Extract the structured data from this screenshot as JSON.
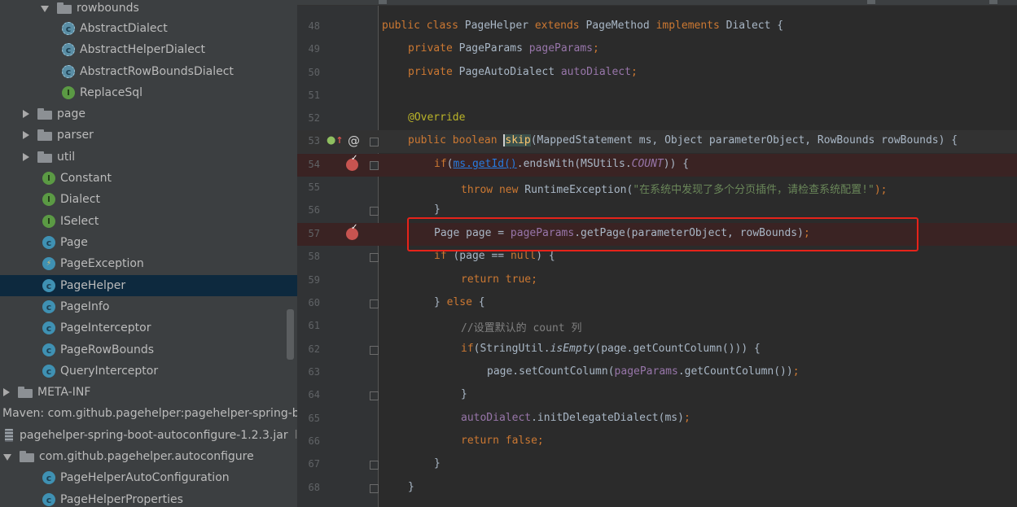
{
  "project_tree": {
    "items": [
      {
        "label": "rowbounds",
        "kind": "folder"
      },
      {
        "label": "AbstractDialect",
        "kind": "abstract-class"
      },
      {
        "label": "AbstractHelperDialect",
        "kind": "abstract-class"
      },
      {
        "label": "AbstractRowBoundsDialect",
        "kind": "abstract-class"
      },
      {
        "label": "ReplaceSql",
        "kind": "interface"
      },
      {
        "label": "page",
        "kind": "folder"
      },
      {
        "label": "parser",
        "kind": "folder"
      },
      {
        "label": "util",
        "kind": "folder"
      },
      {
        "label": "Constant",
        "kind": "interface"
      },
      {
        "label": "Dialect",
        "kind": "interface"
      },
      {
        "label": "ISelect",
        "kind": "interface"
      },
      {
        "label": "Page",
        "kind": "class"
      },
      {
        "label": "PageException",
        "kind": "exception"
      },
      {
        "label": "PageHelper",
        "kind": "class",
        "selected": true
      },
      {
        "label": "PageInfo",
        "kind": "class"
      },
      {
        "label": "PageInterceptor",
        "kind": "class"
      },
      {
        "label": "PageRowBounds",
        "kind": "class"
      },
      {
        "label": "QueryInterceptor",
        "kind": "class"
      },
      {
        "label": "META-INF",
        "kind": "folder"
      },
      {
        "label": "Maven: com.github.pagehelper:pagehelper-spring-bo",
        "kind": "library"
      },
      {
        "label": "pagehelper-spring-boot-autoconfigure-1.2.3.jar",
        "kind": "jar",
        "suffix": "lil"
      },
      {
        "label": "com.github.pagehelper.autoconfigure",
        "kind": "folder"
      },
      {
        "label": "PageHelperAutoConfiguration",
        "kind": "class"
      },
      {
        "label": "PageHelperProperties",
        "kind": "class"
      }
    ]
  },
  "editor": {
    "gutter_icons": {
      "overrides": "↑",
      "annotation": "@",
      "implements": "↑"
    },
    "lines": [
      {
        "n": "48"
      },
      {
        "n": "49"
      },
      {
        "n": "50"
      },
      {
        "n": "51"
      },
      {
        "n": "52"
      },
      {
        "n": "53"
      },
      {
        "n": "54"
      },
      {
        "n": "55"
      },
      {
        "n": "56"
      },
      {
        "n": "57"
      },
      {
        "n": "58"
      },
      {
        "n": "59"
      },
      {
        "n": "60"
      },
      {
        "n": "61"
      },
      {
        "n": "62"
      },
      {
        "n": "63"
      },
      {
        "n": "64"
      },
      {
        "n": "65"
      },
      {
        "n": "66"
      },
      {
        "n": "67"
      },
      {
        "n": "68"
      }
    ],
    "tokens": {
      "l48": [
        "public class ",
        "PageHelper ",
        "extends ",
        "PageMethod ",
        "implements ",
        "Dialect {"
      ],
      "l49": [
        "private ",
        "PageParams ",
        "pageParams",
        ";"
      ],
      "l50": [
        "private ",
        "PageAutoDialect ",
        "autoDialect",
        ";"
      ],
      "l52": [
        "@Override"
      ],
      "l53": [
        "public boolean ",
        "skip",
        "(MappedStatement ms, Object parameterObject, RowBounds rowBounds) {"
      ],
      "l54": [
        "if",
        "(",
        "ms.getId()",
        ".endsWith(MSUtils.",
        "COUNT",
        ")) {"
      ],
      "l55": [
        "throw new ",
        "RuntimeException(",
        "\"在系统中发现了多个分页插件，请检查系统配置!\"",
        ");"
      ],
      "l56": [
        "}"
      ],
      "l57": [
        "Page page = ",
        "pageParams",
        ".getPage(parameterObject, rowBounds)",
        ";"
      ],
      "l58": [
        "if ",
        "(page == ",
        "null",
        ") {"
      ],
      "l59": [
        "return true",
        ";"
      ],
      "l60": [
        "} ",
        "else ",
        "{"
      ],
      "l61": [
        "//设置默认的 count 列"
      ],
      "l62": [
        "if",
        "(StringUtil.",
        "isEmpty",
        "(page.getCountColumn())) {"
      ],
      "l63": [
        "page.setCountColumn(",
        "pageParams",
        ".getCountColumn())",
        ";"
      ],
      "l64": [
        "}"
      ],
      "l65": [
        "autoDialect",
        ".initDelegateDialect(ms)",
        ";"
      ],
      "l66": [
        "return false",
        ";"
      ],
      "l67": [
        "}"
      ],
      "l68": [
        "}"
      ]
    }
  },
  "colors": {
    "keyword": "#cc7832",
    "field": "#9876aa",
    "string": "#6a8759",
    "annotation": "#bbb529",
    "method": "#ffc66d",
    "highlight_box": "#e6231a",
    "breakpoint": "#c75450"
  }
}
